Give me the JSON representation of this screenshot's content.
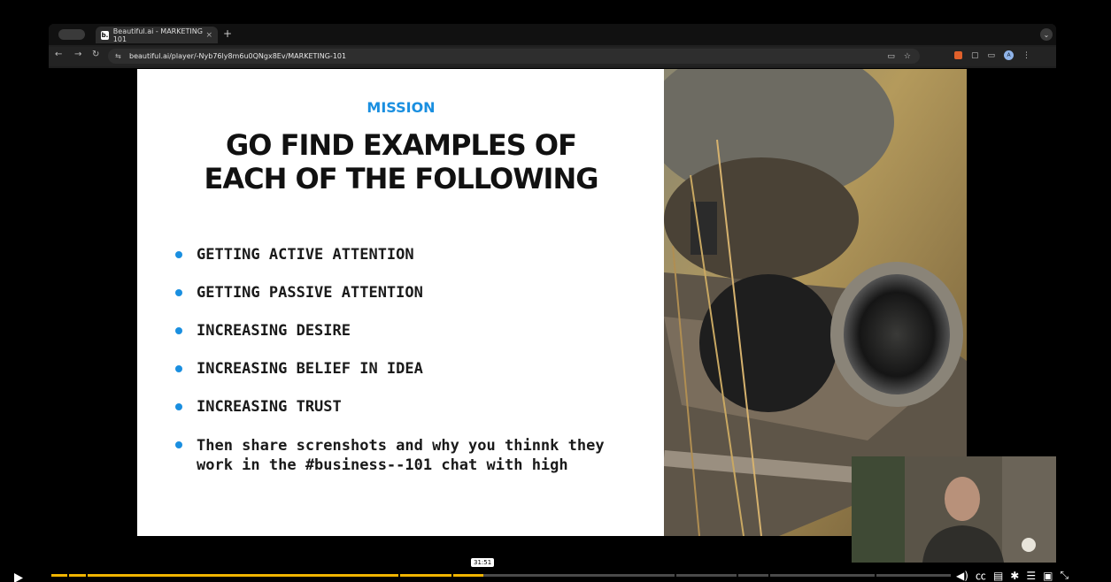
{
  "browser": {
    "tab_title": "Beautiful.ai - MARKETING 101",
    "tab_favicon": "b.",
    "tab_close": "×",
    "new_tab": "+",
    "url": "beautiful.ai/player/-Nyb76ly8m6u0QNgx8Ev/MARKETING-101"
  },
  "slide": {
    "kicker": "MISSION",
    "title_line1": "GO FIND EXAMPLES OF",
    "title_line2": "EACH OF THE FOLLOWING",
    "bullets": [
      "GETTING ACTIVE ATTENTION",
      "GETTING PASSIVE ATTENTION",
      "INCREASING DESIRE",
      "INCREASING BELIEF IN IDEA",
      "INCREASING TRUST",
      "Then share screnshots and why you thinnk they work in the #business--101 chat with high"
    ],
    "accent_color": "#1a8fe0",
    "photo": "scope-icon"
  },
  "player": {
    "time": "31:51",
    "progress": 0.48,
    "progress_color": "#f0b400",
    "controls": [
      "play-icon",
      "volume-icon",
      "captions-icon",
      "transcript-icon",
      "settings-icon",
      "chapters-icon",
      "miniplayer-icon",
      "exit-fullscreen-icon"
    ]
  }
}
